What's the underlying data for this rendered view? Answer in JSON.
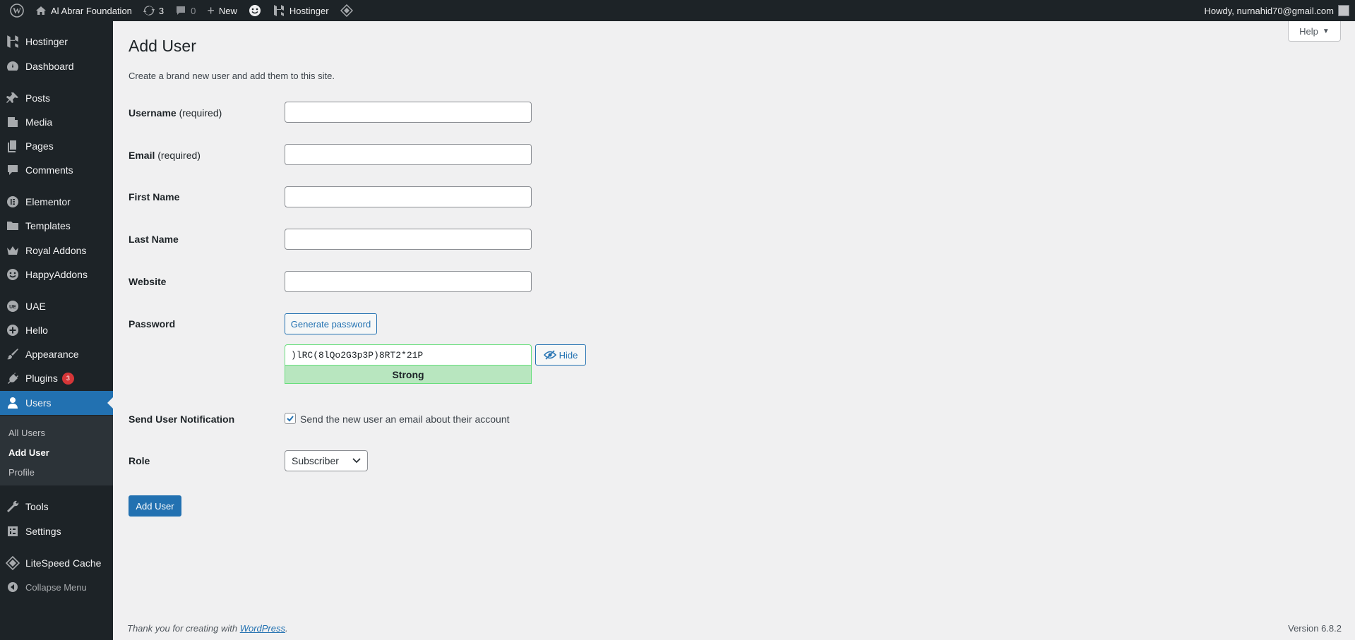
{
  "admin_bar": {
    "site_name": "Al Abrar Foundation",
    "updates_count": "3",
    "comments_count": "0",
    "new_label": "New",
    "hostinger_label": "Hostinger",
    "howdy": "Howdy, nurnahid70@gmail.com"
  },
  "sidebar": {
    "items": [
      {
        "label": "Hostinger",
        "icon": "hostinger-icon"
      },
      {
        "label": "Dashboard",
        "icon": "dashboard-icon"
      },
      {
        "label": "Posts",
        "icon": "pin-icon"
      },
      {
        "label": "Media",
        "icon": "media-icon"
      },
      {
        "label": "Pages",
        "icon": "pages-icon"
      },
      {
        "label": "Comments",
        "icon": "comment-icon"
      },
      {
        "label": "Elementor",
        "icon": "elementor-icon"
      },
      {
        "label": "Templates",
        "icon": "folder-icon"
      },
      {
        "label": "Royal Addons",
        "icon": "crown-icon"
      },
      {
        "label": "HappyAddons",
        "icon": "happy-icon"
      },
      {
        "label": "UAE",
        "icon": "uae-icon"
      },
      {
        "label": "Hello",
        "icon": "plus-circle-icon"
      },
      {
        "label": "Appearance",
        "icon": "brush-icon"
      },
      {
        "label": "Plugins",
        "icon": "plug-icon",
        "badge": "3"
      },
      {
        "label": "Users",
        "icon": "user-icon"
      },
      {
        "label": "Tools",
        "icon": "wrench-icon"
      },
      {
        "label": "Settings",
        "icon": "settings-icon"
      },
      {
        "label": "LiteSpeed Cache",
        "icon": "diamond-icon"
      },
      {
        "label": "Collapse Menu",
        "icon": "collapse-icon"
      }
    ],
    "users_submenu": [
      "All Users",
      "Add User",
      "Profile"
    ]
  },
  "page": {
    "help_label": "Help",
    "title": "Add User",
    "intro": "Create a brand new user and add them to this site."
  },
  "form": {
    "username_label": "Username",
    "username_req": "(required)",
    "email_label": "Email",
    "email_req": "(required)",
    "first_name_label": "First Name",
    "last_name_label": "Last Name",
    "website_label": "Website",
    "password_label": "Password",
    "generate_password": "Generate password",
    "password_value": ")lRC(8lQo2G3p3P)8RT2*21P",
    "hide_label": "Hide",
    "strength": "Strong",
    "notification_label": "Send User Notification",
    "notification_text": "Send the new user an email about their account",
    "notification_checked": true,
    "role_label": "Role",
    "role_value": "Subscriber",
    "submit": "Add User"
  },
  "footer": {
    "thanks_prefix": "Thank you for creating with ",
    "wp_link": "WordPress",
    "thanks_suffix": ".",
    "version": "Version 6.8.2"
  },
  "colors": {
    "accent": "#2271b1",
    "sidebar_bg": "#1d2327",
    "strength_bg": "#b8e6bf",
    "badge": "#d63638"
  }
}
